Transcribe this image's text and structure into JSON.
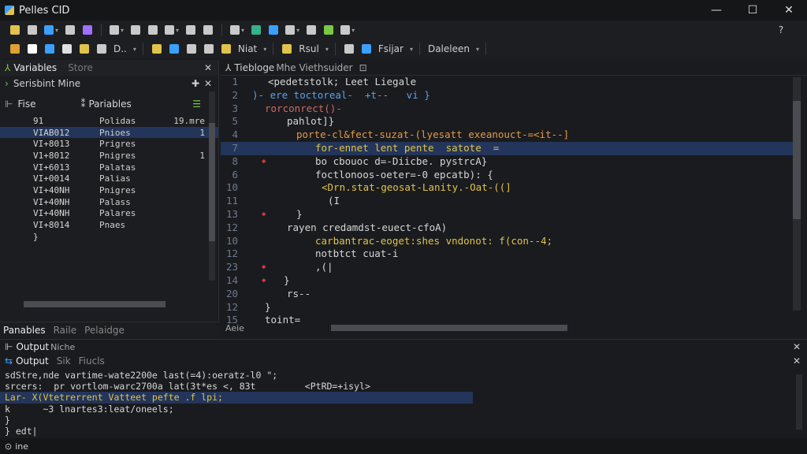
{
  "window": {
    "title": "Pelles CID",
    "controls": [
      "—",
      "☐",
      "✕"
    ]
  },
  "toolbar1": {
    "buttons": [
      {
        "name": "new-file-icon",
        "color": "#e0c34a"
      },
      {
        "name": "open-file-icon",
        "color": "#c9c9c9"
      },
      {
        "name": "back-icon",
        "color": "#3aa0ff"
      },
      {
        "name": "forward-icon",
        "color": "#c9c9c9"
      },
      {
        "name": "bookmark-icon",
        "color": "#a070ff"
      },
      {
        "name": "copy-icon",
        "color": "#c9c9c9"
      },
      {
        "name": "paste-icon",
        "color": "#c9c9c9"
      },
      {
        "name": "clipboard-icon",
        "color": "#c9c9c9"
      },
      {
        "name": "build-icon",
        "color": "#c9c9c9"
      },
      {
        "name": "edit-icon",
        "color": "#c9c9c9"
      },
      {
        "name": "doc-icon",
        "color": "#c9c9c9"
      },
      {
        "name": "run-icon",
        "color": "#c9c9c9"
      },
      {
        "name": "find-icon",
        "color": "#34b28a"
      },
      {
        "name": "search-icon",
        "color": "#3aa0ff"
      },
      {
        "name": "stop-icon",
        "color": "#c9c9c9"
      },
      {
        "name": "zoom-icon",
        "color": "#c9c9c9"
      },
      {
        "name": "branch-icon",
        "color": "#7ac943"
      },
      {
        "name": "tools-icon",
        "color": "#c9c9c9"
      }
    ],
    "right_icon": "?"
  },
  "toolbar2": {
    "items": [
      {
        "type": "icon",
        "name": "folder-icon",
        "color": "#e0a030"
      },
      {
        "type": "icon",
        "name": "add-icon",
        "color": "#ffffff"
      },
      {
        "type": "icon",
        "name": "link-icon",
        "color": "#3aa0ff"
      },
      {
        "type": "icon",
        "name": "delete-icon",
        "color": "#e0e0e0"
      },
      {
        "type": "icon",
        "name": "page-icon",
        "color": "#e0c34a"
      },
      {
        "type": "icon",
        "name": "file-icon",
        "color": "#c9c9c9"
      },
      {
        "type": "label",
        "text": "D.."
      },
      {
        "type": "icon",
        "name": "bracket-icon",
        "color": "#e0c34a"
      },
      {
        "type": "icon",
        "name": "grid-icon",
        "color": "#3aa0ff"
      },
      {
        "type": "icon",
        "name": "list-icon",
        "color": "#c9c9c9"
      },
      {
        "type": "icon",
        "name": "dash-icon",
        "color": "#c9c9c9"
      },
      {
        "type": "icon",
        "name": "n-icon",
        "color": "#e0c34a"
      },
      {
        "type": "label",
        "text": "Niat"
      },
      {
        "type": "icon",
        "name": "square-icon",
        "color": "#e0c34a"
      },
      {
        "type": "label",
        "text": "Rsul"
      },
      {
        "type": "icon",
        "name": "undo-icon",
        "color": "#c9c9c9"
      },
      {
        "type": "icon",
        "name": "redo-icon",
        "color": "#3aa0ff"
      },
      {
        "type": "label",
        "text": "Fsijar"
      },
      {
        "type": "label",
        "text": "Daleleen"
      }
    ]
  },
  "left_panel": {
    "tab_title": "Variables",
    "tab_secondary": "Store",
    "sub_header": "Serisbint Mine",
    "columns": [
      "Fise",
      "Pariables"
    ],
    "rows": [
      {
        "name": "91",
        "type": "Polidas",
        "value": "19.mre"
      },
      {
        "name": "VIAB012",
        "type": "Pnioes",
        "value": "1"
      },
      {
        "name": "VI+8013",
        "type": "Prigres",
        "value": ""
      },
      {
        "name": "V1+8012",
        "type": "Pnigres",
        "value": "1"
      },
      {
        "name": "VI+6013",
        "type": "Palatas",
        "value": ""
      },
      {
        "name": "VI+0014",
        "type": "Palias",
        "value": ""
      },
      {
        "name": "VI+40NH",
        "type": "Pnigres",
        "value": ""
      },
      {
        "name": "VI+40NH",
        "type": "Palass",
        "value": ""
      },
      {
        "name": "VI+40NH",
        "type": "Palares",
        "value": ""
      },
      {
        "name": "VI+8014",
        "type": "Pnaes",
        "value": ""
      },
      {
        "name": "}",
        "type": "",
        "value": ""
      }
    ],
    "bottom_tabs": [
      "Panables",
      "Raile",
      "Pelaidge"
    ]
  },
  "editor": {
    "tab_title": "Tiebloge",
    "tab_sub": "Mhe Viethsuider",
    "lines": [
      {
        "n": "1",
        "text": "<pedetstolk; Leet Liegale",
        "indent": 60,
        "color": "#d6d6d6"
      },
      {
        "n": "2",
        "text": ")- ere toctoreal-  +t--   vi }",
        "indent": 40,
        "color": "#5aa0f0"
      },
      {
        "n": "3",
        "text": "rorconrect()-",
        "indent": 56,
        "color": "#cc6a6a"
      },
      {
        "n": "5",
        "text": "pahlot]}",
        "indent": 84,
        "color": "#d6d6d6"
      },
      {
        "n": "4",
        "text": "porte-cl&fect-suzat-(lyesatt exeanouct-=<it--]",
        "indent": 96,
        "color": "#e09a4a"
      },
      {
        "n": "7",
        "text": "for-ennet lent pente  satote  =",
        "indent": 120,
        "color": "#e0c34a",
        "hl": true
      },
      {
        "n": "8",
        "text": "bo cbouoc d=-Diicbe. pystrcA}",
        "indent": 120,
        "color": "#d6d6d6"
      },
      {
        "n": "6",
        "text": "foctlonoos-oeter=-0 epcatb): {",
        "indent": 120,
        "color": "#d6d6d6"
      },
      {
        "n": "10",
        "text": "<Drn.stat-geosat-Lanity.-Oat-((]",
        "indent": 128,
        "color": "#e0c34a"
      },
      {
        "n": "11",
        "text": "(I",
        "indent": 136,
        "color": "#d6d6d6"
      },
      {
        "n": "13",
        "text": "}",
        "indent": 96,
        "color": "#d6d6d6"
      },
      {
        "n": "12",
        "text": "rayen credamdst-euect-cfoA)",
        "indent": 84,
        "color": "#d6d6d6"
      },
      {
        "n": "10",
        "text": "carbantrac-eoget:shes vndonot: f(con--4;",
        "indent": 120,
        "color": "#e0c34a"
      },
      {
        "n": "12",
        "text": "notbtct cuat-i",
        "indent": 120,
        "color": "#d6d6d6"
      },
      {
        "n": "23",
        "text": ",(|",
        "indent": 120,
        "color": "#d6d6d6"
      },
      {
        "n": "14",
        "text": "}",
        "indent": 80,
        "color": "#d6d6d6"
      },
      {
        "n": "20",
        "text": "rs--",
        "indent": 84,
        "color": "#d6d6d6"
      },
      {
        "n": "12",
        "text": "}",
        "indent": 56,
        "color": "#d6d6d6"
      },
      {
        "n": "15",
        "text": "toint=",
        "indent": 56,
        "color": "#d6d6d6"
      }
    ],
    "markers_rows": [
      6,
      10,
      14,
      15
    ],
    "bottom_label": "Aeie"
  },
  "output": {
    "title": "Output",
    "title_sub": "Niche",
    "tabs": [
      "Output",
      "Sik",
      "Fiucls"
    ],
    "lines": [
      {
        "text": "sdStre,nde vartime-wate2200e last(=4):oeratz-l0 \";",
        "color": "#d6d6d6"
      },
      {
        "text": "srcers:  pr vortlom-warc2700a lat(3t*es <, 83t         <PtRD=+isyl>",
        "color": "#d6d6d6"
      },
      {
        "text": "Lar- X(Vtetrerrent Vatteet pefte .f lpi;",
        "color": "#e0c34a",
        "hl": true
      },
      {
        "text": "k      ~3 lnartes3:leat/oneels;",
        "color": "#d6d6d6"
      },
      {
        "text": "}",
        "color": "#d6d6d6"
      },
      {
        "text": "} edt|",
        "color": "#d6d6d6"
      }
    ]
  },
  "status": {
    "text": "ine"
  }
}
